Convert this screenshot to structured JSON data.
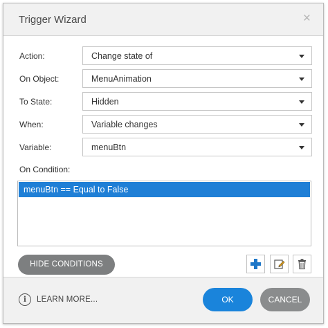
{
  "dialog": {
    "title": "Trigger Wizard",
    "close_label": "×"
  },
  "fields": [
    {
      "label": "Action:",
      "value": "Change state of"
    },
    {
      "label": "On Object:",
      "value": "MenuAnimation"
    },
    {
      "label": "To State:",
      "value": "Hidden"
    },
    {
      "label": "When:",
      "value": "Variable changes"
    },
    {
      "label": "Variable:",
      "value": "menuBtn"
    }
  ],
  "conditions": {
    "label": "On Condition:",
    "items": [
      "menuBtn == Equal to False"
    ],
    "hide_label": "HIDE CONDITIONS"
  },
  "footer": {
    "info_glyph": "i",
    "learn_more": "LEARN MORE...",
    "ok_label": "OK",
    "cancel_label": "CANCEL"
  },
  "colors": {
    "accent": "#1a84db",
    "selection": "#1f7fd6",
    "add_icon": "#1e77c8",
    "secondary_button": "#8a8c8d"
  },
  "icons": [
    "close-icon",
    "chevron-down-icon",
    "add-icon",
    "edit-icon",
    "trash-icon",
    "info-icon"
  ]
}
